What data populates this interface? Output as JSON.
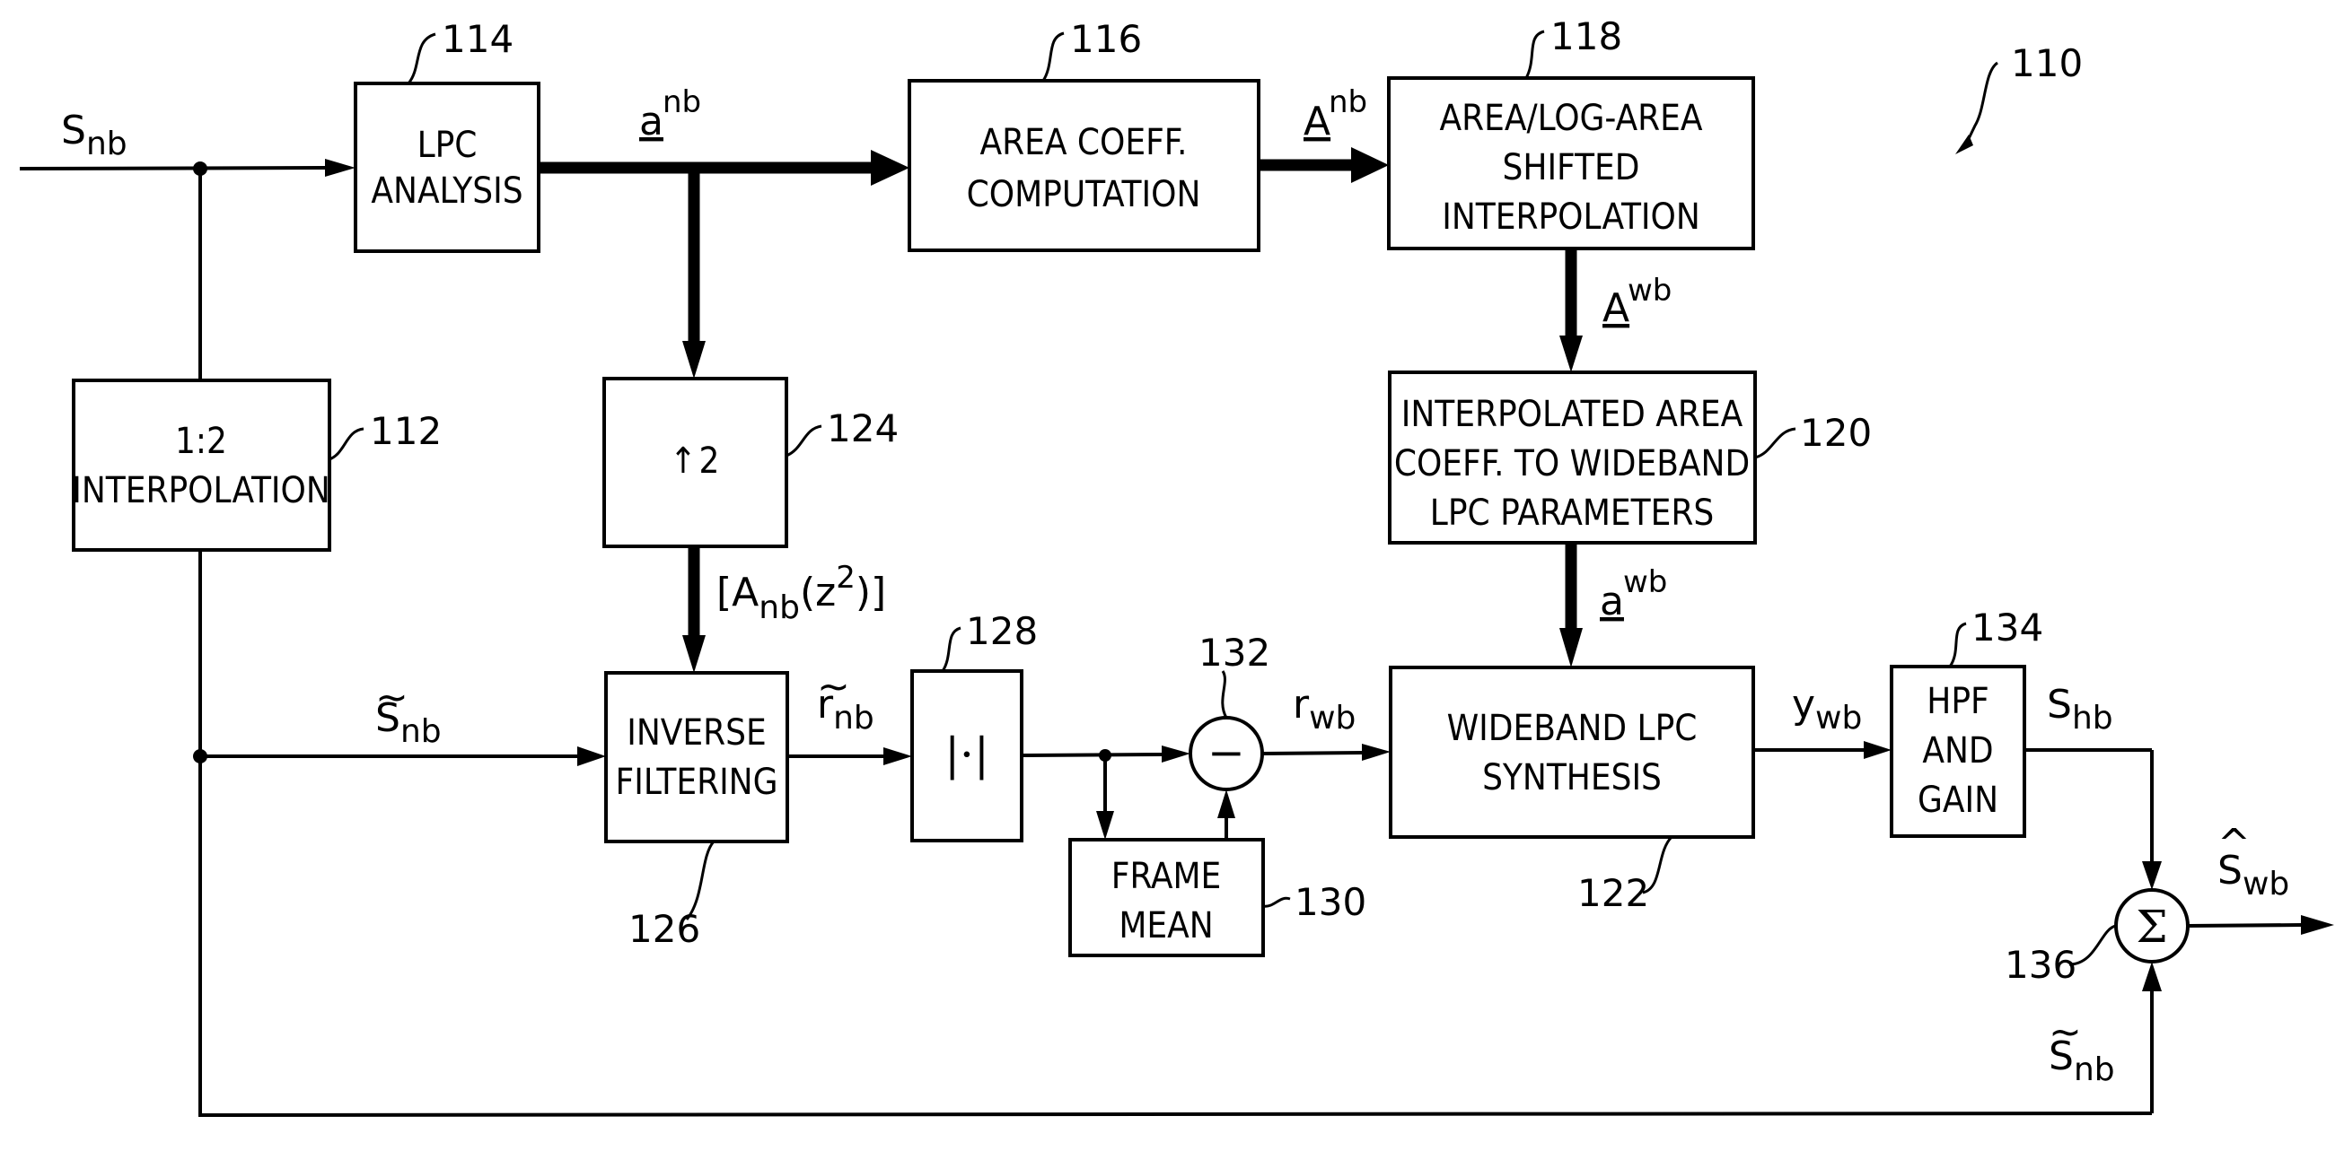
{
  "figure": {
    "reference": "110",
    "colors": {
      "ink": "#000000",
      "paper": "#ffffff"
    }
  },
  "blocks": {
    "interp12": {
      "ref": "112",
      "lines": [
        "1:2",
        "INTERPOLATION"
      ]
    },
    "lpc_analysis": {
      "ref": "114",
      "lines": [
        "LPC",
        "ANALYSIS"
      ]
    },
    "area_coeff": {
      "ref": "116",
      "lines": [
        "AREA  COEFF.",
        "COMPUTATION"
      ]
    },
    "area_log": {
      "ref": "118",
      "lines": [
        "AREA/LOG-AREA",
        "SHIFTED",
        "INTERPOLATION"
      ]
    },
    "interp_area": {
      "ref": "120",
      "lines": [
        "INTERPOLATED  AREA",
        "COEFF.  TO  WIDEBAND",
        "LPC  PARAMETERS"
      ]
    },
    "wb_synth": {
      "ref": "122",
      "lines": [
        "WIDEBAND  LPC",
        "SYNTHESIS"
      ]
    },
    "upsample": {
      "ref": "124",
      "arrow": "↑",
      "factor": "2"
    },
    "inverse_filter": {
      "ref": "126",
      "lines": [
        "INVERSE",
        "FILTERING"
      ]
    },
    "abs": {
      "ref": "128",
      "symbol": "|·|"
    },
    "frame_mean": {
      "ref": "130",
      "lines": [
        "FRAME",
        "MEAN"
      ]
    },
    "subtract": {
      "ref": "132",
      "symbol": "−"
    },
    "hpf_gain": {
      "ref": "134",
      "lines": [
        "HPF",
        "AND",
        "GAIN"
      ]
    },
    "sum": {
      "ref": "136",
      "symbol": "Σ"
    }
  },
  "signals": {
    "s_nb_in": {
      "base": "S",
      "sub": "nb",
      "accent": ""
    },
    "a_nb": {
      "base": "a",
      "sup": "nb",
      "underline": true
    },
    "A_nb": {
      "base": "A",
      "sup": "nb",
      "underline": true
    },
    "A_wb": {
      "base": "A",
      "sup": "wb",
      "underline": true
    },
    "a_wb": {
      "base": "a",
      "sup": "wb",
      "underline": true
    },
    "A_nb_z2": {
      "open": "[A",
      "sub": "nb",
      "mid": "(z",
      "sup": "2",
      "close": ")]"
    },
    "s_nb_tilde": {
      "base": "S",
      "sub": "nb",
      "accent": "~"
    },
    "r_nb_tilde": {
      "base": "r",
      "sub": "nb",
      "accent": "~"
    },
    "r_wb": {
      "base": "r",
      "sub": "wb"
    },
    "y_wb": {
      "base": "y",
      "sub": "wb"
    },
    "s_hb": {
      "base": "S",
      "sub": "hb"
    },
    "s_wb_hat": {
      "base": "S",
      "sub": "wb",
      "accent": "^"
    },
    "s_nb_tilde_bottom": {
      "base": "S",
      "sub": "nb",
      "accent": "~"
    }
  }
}
